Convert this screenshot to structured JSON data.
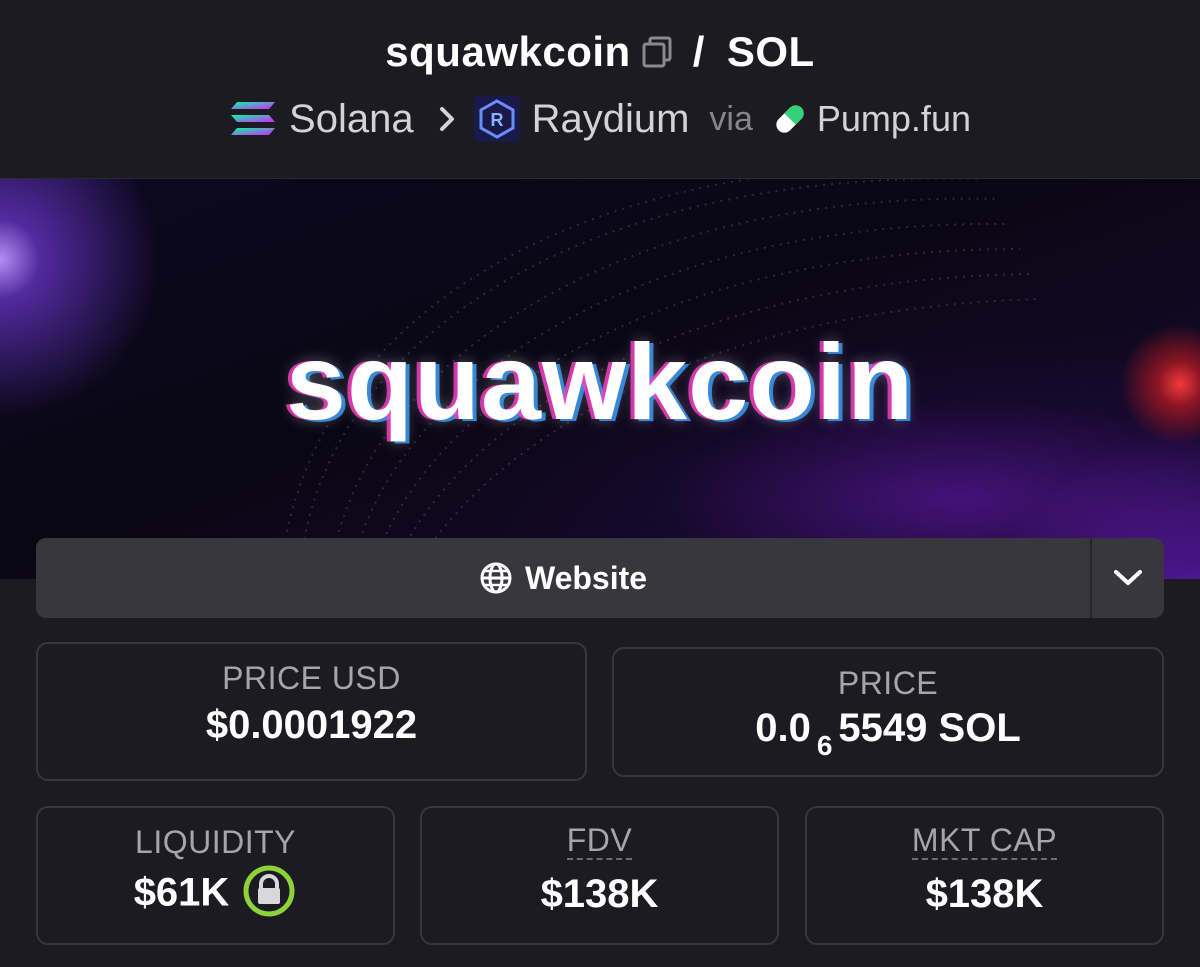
{
  "header": {
    "token_name": "squawkcoin",
    "separator": "/",
    "quote": "SOL",
    "chain": "Solana",
    "dex": "Raydium",
    "via_label": "via",
    "launchpad": "Pump.fun"
  },
  "banner": {
    "text": "squawkcoin"
  },
  "links": {
    "website_label": "Website"
  },
  "stats": {
    "price_usd_label": "PRICE USD",
    "price_usd_value": "$0.0001922",
    "price_label": "PRICE",
    "price_prefix": "0.0",
    "price_zero_count": "6",
    "price_suffix": "5549 SOL",
    "liquidity_label": "LIQUIDITY",
    "liquidity_value": "$61K",
    "fdv_label": "FDV",
    "fdv_value": "$138K",
    "mktcap_label": "MKT CAP",
    "mktcap_value": "$138K"
  },
  "colors": {
    "background": "#1c1b21",
    "card_border": "#38373d",
    "lock_ring": "#8ed23a",
    "pump_green": "#36d07a"
  },
  "icons": [
    "copy-icon",
    "solana-logo-icon",
    "chevron-right-icon",
    "raydium-logo-icon",
    "pill-icon",
    "globe-icon",
    "chevron-down-icon",
    "lock-icon"
  ]
}
